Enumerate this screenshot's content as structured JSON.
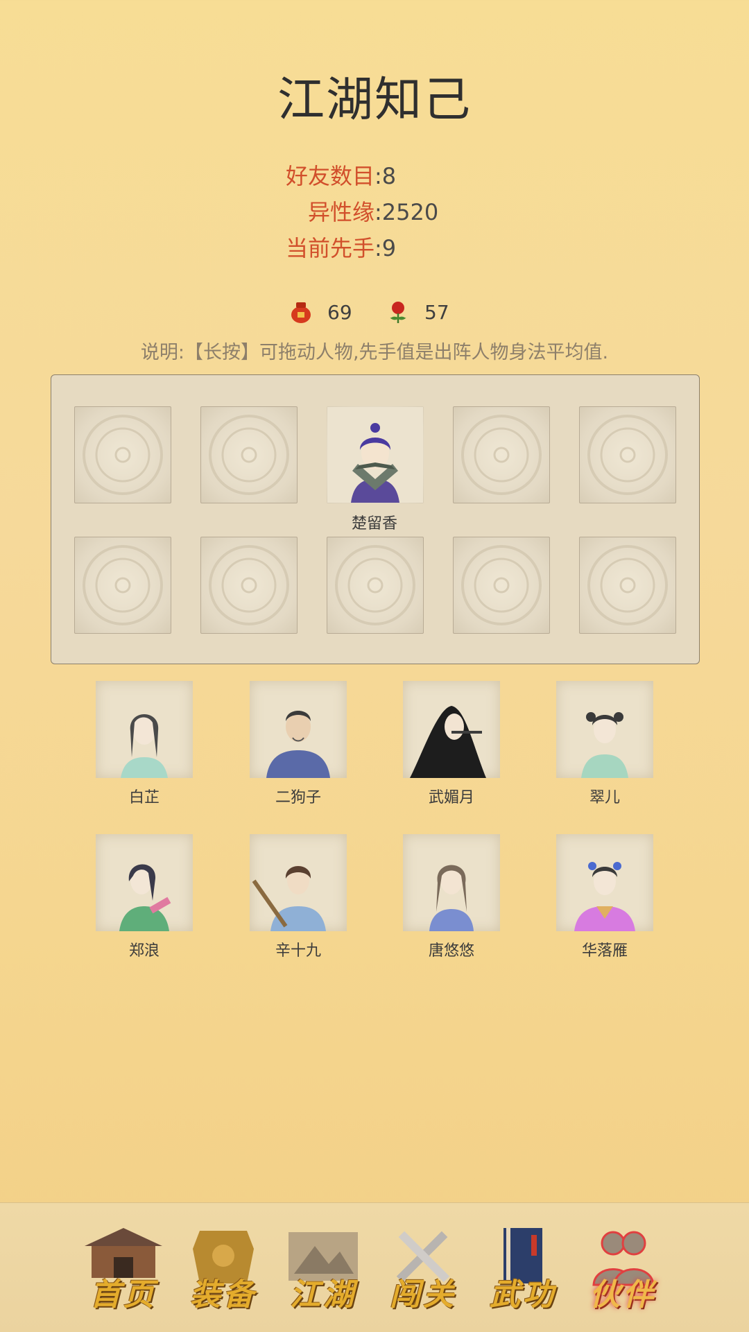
{
  "header": {
    "title": "江湖知己"
  },
  "stats": [
    {
      "label": "好友数目",
      "value": "8"
    },
    {
      "label": "异性缘",
      "value": "2520"
    },
    {
      "label": "当前先手",
      "value": "9"
    }
  ],
  "counters": {
    "wine": {
      "icon": "wine-jar-icon",
      "value": "69"
    },
    "rose": {
      "icon": "rose-icon",
      "value": "57"
    }
  },
  "note": "说明:【长按】可拖动人物,先手值是出阵人物身法平均值.",
  "formation": {
    "slots": [
      {
        "name": ""
      },
      {
        "name": ""
      },
      {
        "name": "楚留香"
      },
      {
        "name": ""
      },
      {
        "name": ""
      },
      {
        "name": ""
      },
      {
        "name": ""
      },
      {
        "name": ""
      },
      {
        "name": ""
      },
      {
        "name": ""
      }
    ]
  },
  "friends": [
    {
      "name": "白芷"
    },
    {
      "name": "二狗子"
    },
    {
      "name": "武媚月"
    },
    {
      "name": "翠儿"
    },
    {
      "name": "郑浪"
    },
    {
      "name": "辛十九"
    },
    {
      "name": "唐悠悠"
    },
    {
      "name": "华落雁"
    }
  ],
  "nav": [
    {
      "label": "首页",
      "icon": "house-icon"
    },
    {
      "label": "装备",
      "icon": "armor-icon"
    },
    {
      "label": "江湖",
      "icon": "scroll-map-icon"
    },
    {
      "label": "闯关",
      "icon": "crossed-swords-icon"
    },
    {
      "label": "武功",
      "icon": "book-icon"
    },
    {
      "label": "伙伴",
      "icon": "partners-icon",
      "active": true
    }
  ],
  "colors": {
    "accent": "#d14f2b",
    "background": "#f6d99a",
    "nav_text": "#e4ac2c"
  }
}
